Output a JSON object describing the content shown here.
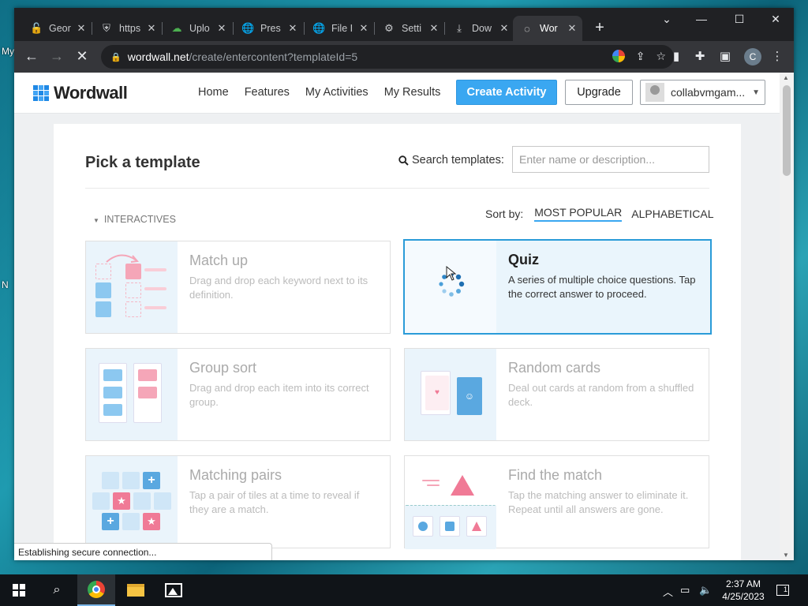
{
  "desktop": {
    "labels": [
      "My",
      "N"
    ]
  },
  "browser": {
    "tabs": [
      {
        "label": "Geor",
        "icon": "lock-icon"
      },
      {
        "label": "https",
        "icon": "shield-icon"
      },
      {
        "label": "Uplo",
        "icon": "cloud-icon"
      },
      {
        "label": "Pres",
        "icon": "globe-icon"
      },
      {
        "label": "File I",
        "icon": "globe-icon"
      },
      {
        "label": "Setti",
        "icon": "gear-icon"
      },
      {
        "label": "Dow",
        "icon": "download-icon"
      },
      {
        "label": "Wor",
        "icon": "loading-icon"
      }
    ],
    "active_tab": 7,
    "url_host": "wordwall.net",
    "url_path": "/create/entercontent?templateId=5",
    "profile_initial": "C"
  },
  "site": {
    "logo": "Wordwall",
    "nav": [
      "Home",
      "Features",
      "My Activities",
      "My Results"
    ],
    "create_label": "Create Activity",
    "upgrade_label": "Upgrade",
    "user_name": "collabvmgam..."
  },
  "panel": {
    "title": "Pick a template",
    "search_label": "Search templates:",
    "search_placeholder": "Enter name or description...",
    "section": "INTERACTIVES",
    "sort_label": "Sort by:",
    "sort_options": [
      "MOST POPULAR",
      "ALPHABETICAL"
    ],
    "sort_active": "MOST POPULAR"
  },
  "templates": [
    {
      "name": "Match up",
      "description": "Drag and drop each keyword next to its definition.",
      "selected": false
    },
    {
      "name": "Quiz",
      "description": "A series of multiple choice questions. Tap the correct answer to proceed.",
      "selected": true
    },
    {
      "name": "Group sort",
      "description": "Drag and drop each item into its correct group.",
      "selected": false
    },
    {
      "name": "Random cards",
      "description": "Deal out cards at random from a shuffled deck.",
      "selected": false
    },
    {
      "name": "Matching pairs",
      "description": "Tap a pair of tiles at a time to reveal if they are a match.",
      "selected": false
    },
    {
      "name": "Find the match",
      "description": "Tap the matching answer to eliminate it. Repeat until all answers are gone.",
      "selected": false
    }
  ],
  "status": "Establishing secure connection...",
  "taskbar": {
    "time": "2:37 AM",
    "date": "4/25/2023",
    "notifications": "1"
  },
  "colors": {
    "accent": "#3aa7f1",
    "pink": "#f5a6b8",
    "blue": "#8cc8f0"
  }
}
